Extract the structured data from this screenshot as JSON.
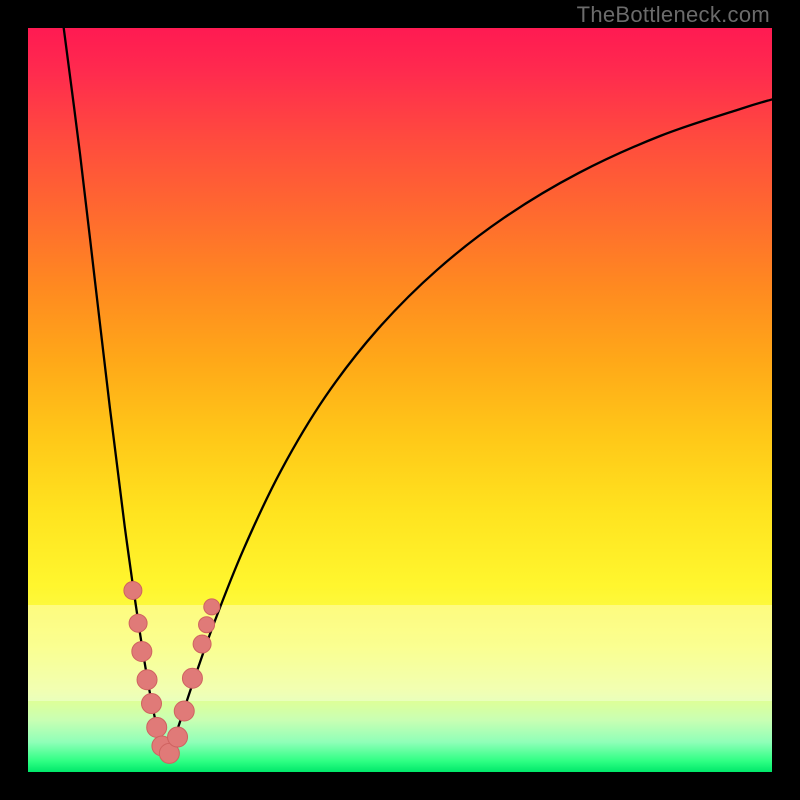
{
  "watermark": "TheBottleneck.com",
  "colors": {
    "frame": "#000000",
    "curve_stroke": "#000000",
    "marker_fill": "#e07a78",
    "marker_stroke": "#cf6260"
  },
  "chart_data": {
    "type": "line",
    "title": "",
    "xlabel": "",
    "ylabel": "",
    "xlim": [
      0,
      1
    ],
    "ylim": [
      0,
      1
    ],
    "grid": false,
    "legend": false,
    "notes": "Bottleneck-style V-curve. x is normalized horizontal position, y is normalized vertical position (0 at top). Two monotone branches meeting near x≈0.185, y≈0.982.",
    "series": [
      {
        "name": "left-branch",
        "x": [
          0.048,
          0.07,
          0.09,
          0.11,
          0.13,
          0.15,
          0.165,
          0.178,
          0.185
        ],
        "y": [
          0.0,
          0.17,
          0.34,
          0.51,
          0.67,
          0.81,
          0.9,
          0.96,
          0.982
        ]
      },
      {
        "name": "right-branch",
        "x": [
          0.185,
          0.2,
          0.22,
          0.25,
          0.29,
          0.34,
          0.4,
          0.47,
          0.55,
          0.64,
          0.74,
          0.85,
          0.96,
          1.0
        ],
        "y": [
          0.982,
          0.945,
          0.885,
          0.8,
          0.7,
          0.595,
          0.495,
          0.405,
          0.325,
          0.255,
          0.195,
          0.145,
          0.108,
          0.096
        ]
      }
    ],
    "markers": {
      "name": "highlighted-points",
      "note": "Pink dot cluster near the curve minimum.",
      "points": [
        {
          "x": 0.141,
          "y": 0.756,
          "r": 9
        },
        {
          "x": 0.148,
          "y": 0.8,
          "r": 9
        },
        {
          "x": 0.153,
          "y": 0.838,
          "r": 10
        },
        {
          "x": 0.16,
          "y": 0.876,
          "r": 10
        },
        {
          "x": 0.166,
          "y": 0.908,
          "r": 10
        },
        {
          "x": 0.173,
          "y": 0.94,
          "r": 10
        },
        {
          "x": 0.18,
          "y": 0.965,
          "r": 10
        },
        {
          "x": 0.19,
          "y": 0.975,
          "r": 10
        },
        {
          "x": 0.201,
          "y": 0.953,
          "r": 10
        },
        {
          "x": 0.21,
          "y": 0.918,
          "r": 10
        },
        {
          "x": 0.221,
          "y": 0.874,
          "r": 10
        },
        {
          "x": 0.234,
          "y": 0.828,
          "r": 9
        },
        {
          "x": 0.24,
          "y": 0.802,
          "r": 8
        },
        {
          "x": 0.247,
          "y": 0.778,
          "r": 8
        }
      ]
    },
    "pale_band": {
      "top": 0.775,
      "bottom": 0.905
    }
  }
}
